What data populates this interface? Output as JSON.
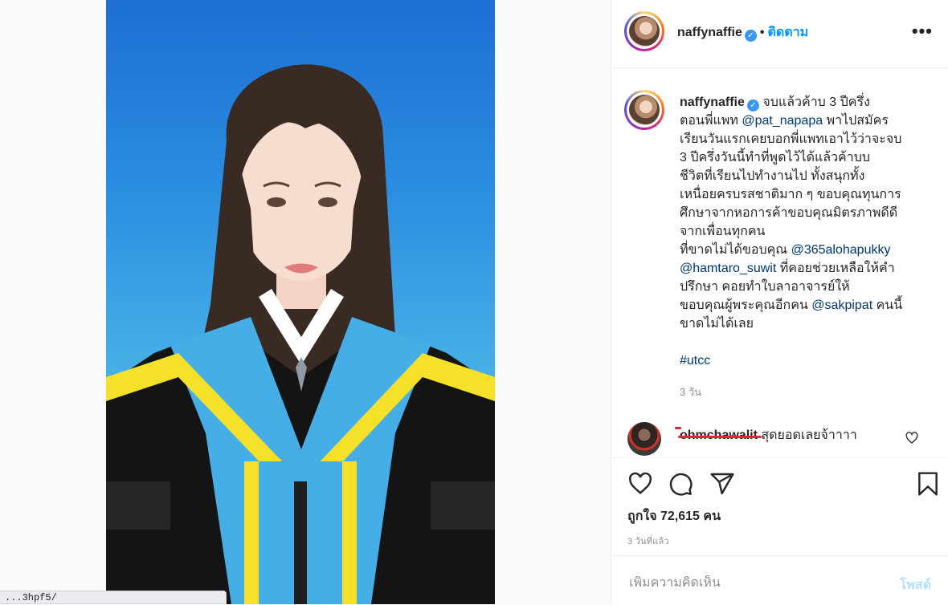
{
  "status_url": "...3hpf5/",
  "post": {
    "username": "naffynaffie",
    "verified_icon": "verified-badge-icon",
    "separator": "•",
    "follow_label": "ติดตาม",
    "more_icon": "more-options-icon",
    "more_label": "•••"
  },
  "caption": {
    "username": "naffynaffie",
    "lines": [
      {
        "parts": [
          {
            "t": "จบแล้วค้าบ 3 ปีครึ่ง"
          }
        ]
      },
      {
        "parts": [
          {
            "t": "ตอนพี่แพท "
          },
          {
            "t": "@pat_napapa",
            "m": true
          },
          {
            "t": " พาไปสมัคร"
          }
        ]
      },
      {
        "parts": [
          {
            "t": "เรียนวันแรกเคยบอกพี่แพทเอาไว้ว่าจะจบ"
          }
        ]
      },
      {
        "parts": [
          {
            "t": "3 ปีครึ่งวันนี้ทำที่พูดไว้ได้แล้วค้าบบ"
          }
        ]
      },
      {
        "parts": [
          {
            "t": "ชีวิตที่เรียนไปทำงานไป ทั้งสนุกทั้ง"
          }
        ]
      },
      {
        "parts": [
          {
            "t": "เหนื่อยครบรสชาติมาก ๆ ขอบคุณทุนการ"
          }
        ]
      },
      {
        "parts": [
          {
            "t": "ศึกษาจากหอการค้าขอบคุณมิตรภาพดีดี"
          }
        ]
      },
      {
        "parts": [
          {
            "t": "จากเพื่อนทุกคน"
          }
        ]
      },
      {
        "parts": [
          {
            "t": "ที่ขาดไม่ได้ขอบคุณ "
          },
          {
            "t": "@365alohapukky",
            "m": true
          }
        ]
      },
      {
        "parts": [
          {
            "t": "@hamtaro_suwit",
            "m": true
          },
          {
            "t": " ที่คอยช่วยเหลือให้คำ"
          }
        ]
      },
      {
        "parts": [
          {
            "t": "ปรึกษา คอยทำใบลาอาจารย์ให้"
          }
        ]
      },
      {
        "parts": [
          {
            "t": "ขอบคุณผู้พระคุณอีกคน "
          },
          {
            "t": "@sakpipat",
            "m": true
          },
          {
            "t": " คนนี้"
          }
        ]
      },
      {
        "parts": [
          {
            "t": "ขาดไม่ได้เลย"
          }
        ]
      },
      {
        "parts": [
          {
            "t": ""
          }
        ]
      },
      {
        "parts": [
          {
            "t": "#utcc",
            "m": true
          }
        ]
      }
    ],
    "time": "3 วัน"
  },
  "comment": {
    "username": "ohmchawalit",
    "text": " สุดยอดเลยจ้าาาา",
    "like_icon": "heart-outline-icon"
  },
  "actions": {
    "icons": [
      "heart-icon",
      "comment-icon",
      "share-icon",
      "bookmark-icon"
    ],
    "likes": "ถูกใจ 72,615 คน",
    "date": "3 วันที่แล้ว"
  },
  "add_comment": {
    "placeholder": "เพิ่มความคิดเห็น",
    "post_label": "โพสต์"
  },
  "colors": {
    "link_blue": "#0095f6",
    "mention": "#00376b",
    "muted": "#8e8e8e",
    "post_disabled": "#b2dffc",
    "photo_bg": "#2a8ce0"
  }
}
